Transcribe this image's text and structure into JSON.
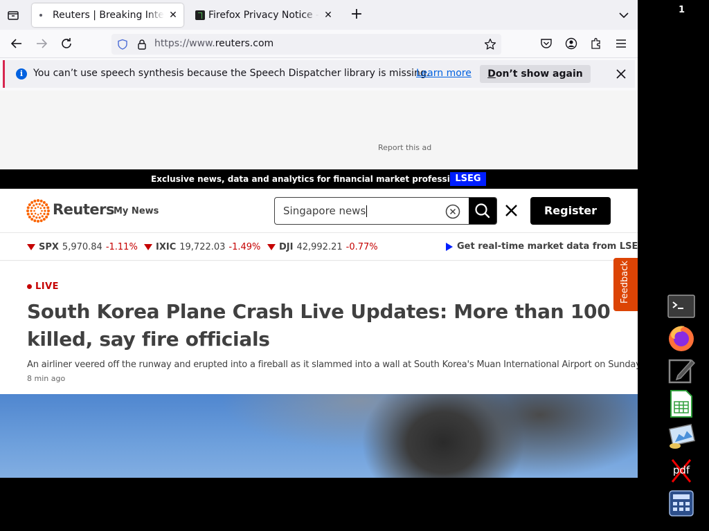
{
  "browser": {
    "tabs": [
      {
        "title": "Reuters | Breaking International News & Views",
        "active": true
      },
      {
        "title": "Firefox Privacy Notice — Mozilla",
        "active": false
      }
    ],
    "url_prefix": "https://www.",
    "url_domain": "reuters.com"
  },
  "notification": {
    "message": "You can’t use speech synthesis because the Speech Dispatcher library is missing.",
    "learn_more": "Learn more",
    "dont_show_first": "D",
    "dont_show_rest": "on’t show again"
  },
  "page": {
    "ad_report": "Report this ad",
    "promo_text": "Exclusive news, data and analytics for financial market professionals",
    "promo_badge": "LSEG",
    "logo": "Reuters",
    "my_news": "My News",
    "search_value": "Singapore news",
    "register": "Register",
    "ticker": [
      {
        "symbol": "SPX",
        "value": "5,970.84",
        "change": "-1.11%"
      },
      {
        "symbol": "IXIC",
        "value": "19,722.03",
        "change": "-1.49%"
      },
      {
        "symbol": "DJI",
        "value": "42,992.21",
        "change": "-0.77%"
      }
    ],
    "market_link": "Get real-time market data from LSEG",
    "feedback": "Feedback",
    "article": {
      "live_label": "LIVE",
      "headline": "South Korea Plane Crash Live Updates: More than 100 killed, say fire officials",
      "summary": "An airliner veered off the runway and erupted into a fireball as it slammed into a wall at South Korea's Muan International Airport on Sunday.",
      "time_ago": "8 min ago"
    }
  },
  "desktop": {
    "workspace_number": "1",
    "dock": [
      "terminal-icon",
      "firefox-icon",
      "text-editor-icon",
      "spreadsheet-icon",
      "image-viewer-icon",
      "pdf-icon",
      "calculator-icon"
    ]
  },
  "colors": {
    "accent_blue": "#0061e0",
    "reuters_orange": "#fa6400",
    "down_red": "#c50000",
    "lseg_blue": "#001eff",
    "feedback_orange": "#dc4405"
  }
}
